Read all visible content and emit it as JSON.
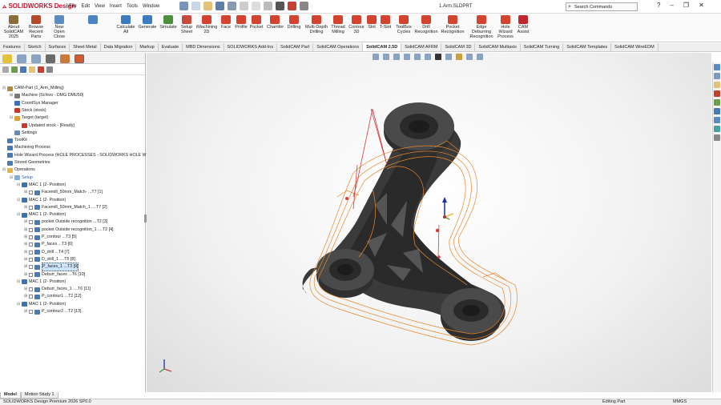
{
  "app": {
    "logo": "SOLIDWORKS Design",
    "menus": [
      "File",
      "Edit",
      "View",
      "Insert",
      "Tools",
      "Window"
    ],
    "doc_title": "1.Arm.SLDPRT",
    "search_placeholder": "Search Commands"
  },
  "ribbon": [
    {
      "label": "About SolidCAM 2025",
      "color": "#8a6d3b"
    },
    {
      "label": "Browse Recent Parts",
      "color": "#b84a2c"
    },
    {
      "label": "New Open Close",
      "color": "#5d8abf"
    },
    {
      "label": "",
      "color": "#4a86c5"
    },
    {
      "label": "Calculate All",
      "color": "#3b7bbf"
    },
    {
      "label": "Generate",
      "color": "#3b7bbf"
    },
    {
      "label": "Simulate",
      "color": "#4c8f3d"
    },
    {
      "label": "Setup Sheet",
      "color": "#c74a3c"
    },
    {
      "label": "iMachining 2D",
      "color": "#d3432f"
    },
    {
      "label": "Face",
      "color": "#d3432f"
    },
    {
      "label": "Profile",
      "color": "#d3432f"
    },
    {
      "label": "Pocket",
      "color": "#d3432f"
    },
    {
      "label": "Chamfer",
      "color": "#d3432f"
    },
    {
      "label": "Drilling",
      "color": "#d3432f"
    },
    {
      "label": "Multi-Depth Drilling",
      "color": "#d3432f"
    },
    {
      "label": "Thread Milling",
      "color": "#d3432f"
    },
    {
      "label": "Contour 3D",
      "color": "#d3432f"
    },
    {
      "label": "Slot",
      "color": "#d3432f"
    },
    {
      "label": "T-Slot",
      "color": "#d3432f"
    },
    {
      "label": "ToolBox Cycles",
      "color": "#d3432f"
    },
    {
      "label": "Drill Recognition",
      "color": "#d3432f"
    },
    {
      "label": "Pocket Recognition",
      "color": "#d3432f"
    },
    {
      "label": "Edge Deburring Recognition",
      "color": "#d3432f"
    },
    {
      "label": "Hole Wizard Process",
      "color": "#d3432f"
    },
    {
      "label": "CAM Assist",
      "color": "#c1272d"
    }
  ],
  "cmd_tabs": [
    "Features",
    "Sketch",
    "Surfaces",
    "Sheet Metal",
    "Data Migration",
    "Markup",
    "Evaluate",
    "MBD Dimensions",
    "SOLIDWORKS Add-Ins",
    "SolidCAM Part",
    "SolidCAM Operations",
    "SolidCAM 2.5D",
    "SolidCAM AFRM",
    "SolidCAM 3D",
    "SolidCAM Multiaxis",
    "SolidCAM Turning",
    "SolidCAM Templates",
    "SolidCAM WireEDM"
  ],
  "active_cmd_tab": "SolidCAM 2.5D",
  "tree": [
    {
      "d": 0,
      "t": "CAM-Part (1_Arm_Milling)",
      "c": "#b48a3c",
      "tog": "⊟"
    },
    {
      "d": 1,
      "t": "Machine (Schivo - DMG DMU50)",
      "c": "#7a7a7a",
      "tog": "⊞"
    },
    {
      "d": 1,
      "t": "CoordSys Manager",
      "c": "#3a72b5",
      "tog": ""
    },
    {
      "d": 1,
      "t": "Stock (stock)",
      "c": "#c63a2e",
      "tog": ""
    },
    {
      "d": 1,
      "t": "Target (target)",
      "c": "#d9a03a",
      "tog": "⊟"
    },
    {
      "d": 2,
      "t": "Updated stock - [Ready]",
      "c": "#c63a2e",
      "tog": ""
    },
    {
      "d": 1,
      "t": "Settings",
      "c": "#6a8ab5",
      "tog": ""
    },
    {
      "d": 0,
      "t": "ToolKit",
      "c": "#4a7ab5",
      "tog": ""
    },
    {
      "d": 0,
      "t": "Machining Process",
      "c": "#4a7ab5",
      "tog": ""
    },
    {
      "d": 0,
      "t": "Hole Wizard Process (HOLE PROCESSES - SOLIDWORKS HOLE WIZA",
      "c": "#4a7ab5",
      "tog": ""
    },
    {
      "d": 0,
      "t": "Stored Geometries",
      "c": "#4a7ab5",
      "tog": ""
    },
    {
      "d": 0,
      "t": "Operations",
      "c": "#e6b24a",
      "tog": "⊟"
    },
    {
      "d": 1,
      "t": "Setup",
      "c": "#8aa8d8",
      "tog": "⊟",
      "blue": true
    },
    {
      "d": 2,
      "t": "MAC 1 (2- Position)",
      "c": "#3a72b5",
      "tog": "⊟"
    },
    {
      "d": 3,
      "t": "Facemill_50mm_Match- ...T7 [1]",
      "c": "#4a7ab5",
      "tog": "⊞",
      "ck": true
    },
    {
      "d": 2,
      "t": "MAC 1 (2- Position)",
      "c": "#3a72b5",
      "tog": "⊟"
    },
    {
      "d": 3,
      "t": "Facemill_50mm_Match_1 ....T7 [2]",
      "c": "#4a7ab5",
      "tog": "⊞",
      "ck": true
    },
    {
      "d": 2,
      "t": "MAC 1 (2- Position)",
      "c": "#3a72b5",
      "tog": "⊟"
    },
    {
      "d": 3,
      "t": "pocket Outside recognition ...T2 [3]",
      "c": "#4a7ab5",
      "tog": "⊞",
      "ck": true
    },
    {
      "d": 3,
      "t": "pocket Outside recognition_1 ....T2 [4]",
      "c": "#4a7ab5",
      "tog": "⊞",
      "ck": true
    },
    {
      "d": 3,
      "t": "P_contour ...T3 [5]",
      "c": "#4a7ab5",
      "tog": "⊞",
      "ck": true
    },
    {
      "d": 3,
      "t": "P_faces ...T3 [6]",
      "c": "#4a7ab5",
      "tog": "⊞",
      "ck": true
    },
    {
      "d": 3,
      "t": "D_drill ...T4 [7]",
      "c": "#4a7ab5",
      "tog": "⊞",
      "ck": true
    },
    {
      "d": 3,
      "t": "D_drill_1 ....T5 [8]",
      "c": "#4a7ab5",
      "tog": "⊞",
      "ck": true
    },
    {
      "d": 3,
      "t": "P_faces_1 ...T3 [9]",
      "c": "#4a7ab5",
      "tog": "⊞",
      "ck": true,
      "sel": true
    },
    {
      "d": 3,
      "t": "Deburr_faces ...T6 [10]",
      "c": "#4a7ab5",
      "tog": "⊞",
      "ck": true
    },
    {
      "d": 2,
      "t": "MAC 1 (2- Position)",
      "c": "#3a72b5",
      "tog": "⊟"
    },
    {
      "d": 3,
      "t": "Deburr_faces_1 ....T6 [11]",
      "c": "#4a7ab5",
      "tog": "⊞",
      "ck": true
    },
    {
      "d": 3,
      "t": "P_contour1 ...T2 [12]",
      "c": "#4a7ab5",
      "tog": "⊞",
      "ck": true
    },
    {
      "d": 2,
      "t": "MAC 1 (2- Position)",
      "c": "#3a72b5",
      "tog": "⊟"
    },
    {
      "d": 3,
      "t": "P_contour2 ...T2 [13]",
      "c": "#4a7ab5",
      "tog": "⊞",
      "ck": true
    }
  ],
  "bottom_tabs": [
    "Model",
    "Motion Study 1"
  ],
  "status": {
    "left": "SOLIDWORKS Design Premium 2026 SP0.0",
    "mid": "Editing Part",
    "units": "MMGS"
  },
  "model": {
    "body_color": "#3a3a3a",
    "toolpath_color": "#e8862a",
    "rapid_color": "#d43d3d"
  }
}
